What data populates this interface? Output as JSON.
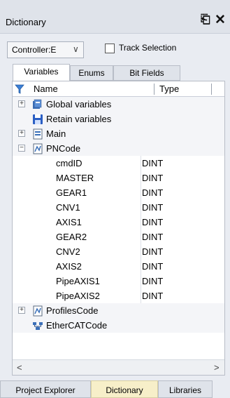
{
  "panel": {
    "title": "Dictionary",
    "pin_icon": "pin-icon",
    "close_icon": "close-icon"
  },
  "toolbar": {
    "controller_value": "Controller:E",
    "track_selection_label": "Track Selection"
  },
  "tabs": [
    {
      "label": "Variables",
      "active": true
    },
    {
      "label": "Enums",
      "active": false
    },
    {
      "label": "Bit Fields",
      "active": false
    }
  ],
  "grid": {
    "columns": [
      "Name",
      "Type"
    ],
    "rows": [
      {
        "name": "Global variables",
        "type": "",
        "icon": "global-variables-icon",
        "expander": "+"
      },
      {
        "name": "Retain variables",
        "type": "",
        "icon": "floppy-disk-icon",
        "expander": ""
      },
      {
        "name": "Main",
        "type": "",
        "icon": "program-icon",
        "expander": "+"
      },
      {
        "name": "PNCode",
        "type": "",
        "icon": "program-icon",
        "expander": "−"
      },
      {
        "name": "cmdID",
        "type": "DINT"
      },
      {
        "name": "MASTER",
        "type": "DINT"
      },
      {
        "name": "GEAR1",
        "type": "DINT"
      },
      {
        "name": "CNV1",
        "type": "DINT"
      },
      {
        "name": "AXIS1",
        "type": "DINT"
      },
      {
        "name": "GEAR2",
        "type": "DINT"
      },
      {
        "name": "CNV2",
        "type": "DINT"
      },
      {
        "name": "AXIS2",
        "type": "DINT"
      },
      {
        "name": "PipeAXIS1",
        "type": "DINT"
      },
      {
        "name": "PipeAXIS2",
        "type": "DINT"
      },
      {
        "name": "ProfilesCode",
        "type": "",
        "icon": "program-icon",
        "expander": "+"
      },
      {
        "name": "EtherCATCode",
        "type": "",
        "icon": "ethercat-icon",
        "expander": ""
      }
    ]
  },
  "scroll": {
    "left_icon": "scroll-left-icon",
    "right_icon": "scroll-right-icon"
  },
  "bottom_tabs": [
    {
      "label": "Project Explorer",
      "active": false
    },
    {
      "label": "Dictionary",
      "active": true
    },
    {
      "label": "Libraries",
      "active": false
    }
  ]
}
